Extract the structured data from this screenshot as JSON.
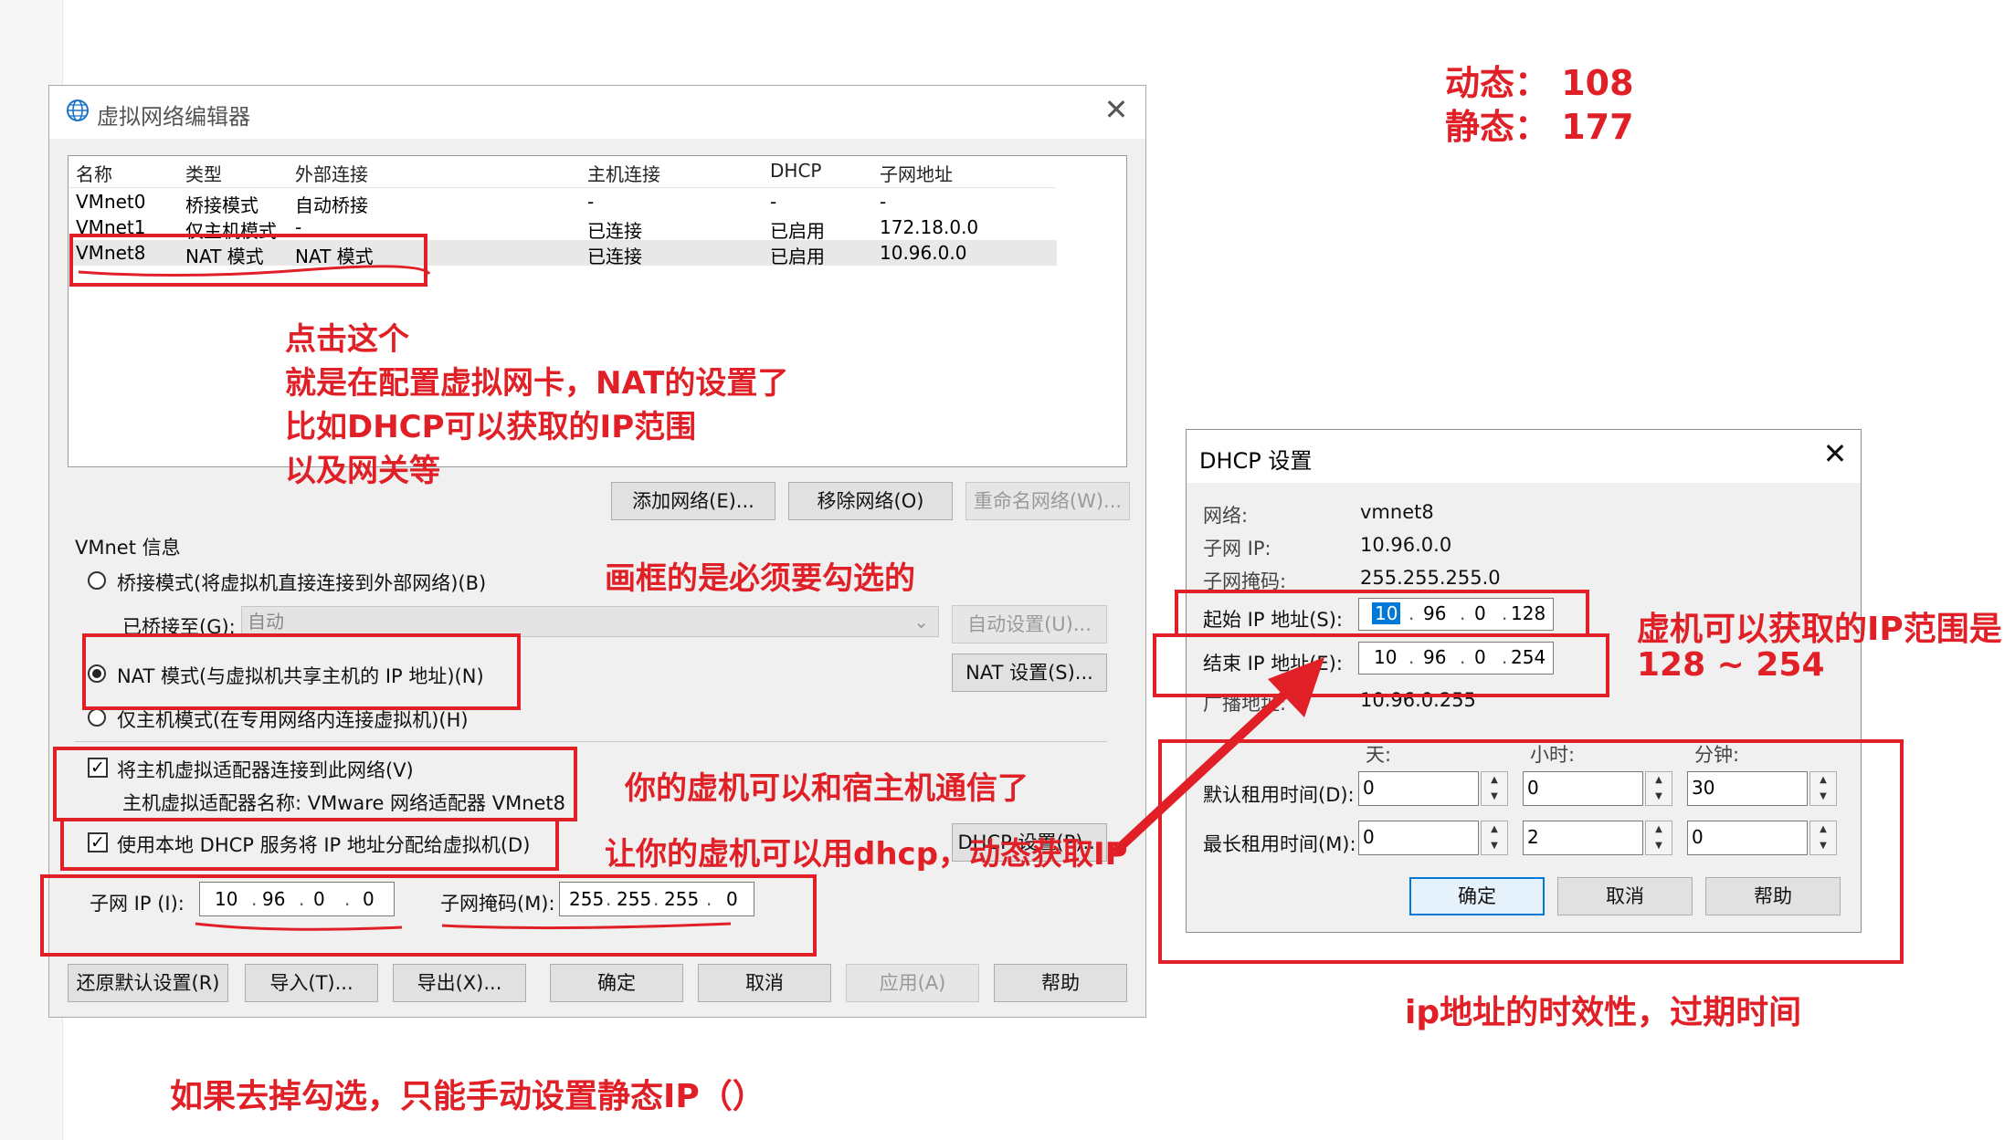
{
  "main_dialog": {
    "title": "虚拟网络编辑器",
    "columns": [
      "名称",
      "类型",
      "外部连接",
      "主机连接",
      "DHCP",
      "子网地址"
    ],
    "rows": [
      [
        "VMnet0",
        "桥接模式",
        "自动桥接",
        "-",
        "-",
        "-"
      ],
      [
        "VMnet1",
        "仅主机模式",
        "-",
        "已连接",
        "已启用",
        "172.18.0.0"
      ],
      [
        "VMnet8",
        "NAT 模式",
        "NAT 模式",
        "已连接",
        "已启用",
        "10.96.0.0"
      ]
    ],
    "add_network": "添加网络(E)...",
    "remove_network": "移除网络(O)",
    "rename_network": "重命名网络(W)...",
    "vmnet_info": "VMnet 信息",
    "bridge_radio": "桥接模式(将虚拟机直接连接到外部网络)(B)",
    "bridged_to_label": "已桥接至(G):",
    "bridged_to_value": "自动",
    "auto_settings": "自动设置(U)...",
    "nat_radio": "NAT 模式(与虚拟机共享主机的 IP 地址)(N)",
    "nat_settings": "NAT 设置(S)...",
    "host_only_radio": "仅主机模式(在专用网络内连接虚拟机)(H)",
    "connect_adapter": "将主机虚拟适配器连接到此网络(V)",
    "adapter_name": "主机虚拟适配器名称: VMware 网络适配器 VMnet8",
    "use_dhcp": "使用本地 DHCP 服务将 IP 地址分配给虚拟机(D)",
    "dhcp_settings": "DHCP 设置(P)...",
    "subnet_ip_label": "子网 IP (I):",
    "subnet_ip": [
      "10",
      "96",
      "0",
      "0"
    ],
    "subnet_mask_label": "子网掩码(M):",
    "subnet_mask": [
      "255",
      "255",
      "255",
      "0"
    ],
    "restore_defaults": "还原默认设置(R)",
    "import": "导入(T)...",
    "export": "导出(X)...",
    "ok": "确定",
    "cancel": "取消",
    "apply": "应用(A)",
    "help": "帮助"
  },
  "dhcp_dialog": {
    "title": "DHCP 设置",
    "network_label": "网络:",
    "network_value": "vmnet8",
    "subnet_ip_label": "子网 IP:",
    "subnet_ip_value": "10.96.0.0",
    "subnet_mask_label": "子网掩码:",
    "subnet_mask_value": "255.255.255.0",
    "start_ip_label": "起始 IP 地址(S):",
    "start_ip": [
      "10",
      "96",
      "0",
      "128"
    ],
    "end_ip_label": "结束 IP 地址(E):",
    "end_ip": [
      "10",
      "96",
      "0",
      "254"
    ],
    "broadcast_label": "广播地址:",
    "broadcast_value": "10.96.0.255",
    "days_label": "天:",
    "hours_label": "小时:",
    "minutes_label": "分钟:",
    "default_lease_label": "默认租用时间(D):",
    "default_lease": [
      "0",
      "0",
      "30"
    ],
    "max_lease_label": "最长租用时间(M):",
    "max_lease": [
      "0",
      "2",
      "0"
    ],
    "ok": "确定",
    "cancel": "取消",
    "help": "帮助"
  },
  "annotations": {
    "dynamic": "动态： 108",
    "static": "静态： 177",
    "click_this_1": "点击这个",
    "click_this_2": "就是在配置虚拟网卡，NAT的设置了",
    "click_this_3": "比如DHCP可以获取的IP范围",
    "click_this_4": "以及网关等",
    "boxed_required": "画框的是必须要勾选的",
    "host_comm": "你的虚机可以和宿主机通信了",
    "use_dhcp": "让你的虚机可以用dhcp，动态获取IP",
    "ip_range_1": "虚机可以获取的IP范围是",
    "ip_range_2": "128 ~ 254",
    "lease_note": "ip地址的时效性，过期时间",
    "manual_note": "如果去掉勾选，只能手动设置静态IP（）"
  },
  "colors": {
    "annotation": "#e01f26",
    "selection": "#0078d7"
  }
}
